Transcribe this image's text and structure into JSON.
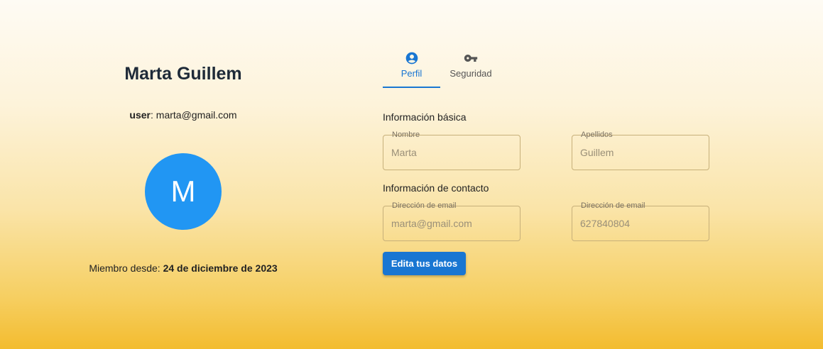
{
  "profile": {
    "name": "Marta Guillem",
    "user_label": "user",
    "user_value": ": marta@gmail.com",
    "avatar_initial": "M",
    "member_since_label": "Miembro desde: ",
    "member_since_value": "24 de diciembre de 2023"
  },
  "tabs": [
    {
      "label": "Perfil",
      "icon": "account-circle-icon",
      "active": true
    },
    {
      "label": "Seguridad",
      "icon": "key-icon",
      "active": false
    }
  ],
  "basic_info": {
    "title": "Información básica",
    "fields": [
      {
        "label": "Nombre",
        "value": "Marta"
      },
      {
        "label": "Apellidos",
        "value": "Guillem"
      }
    ]
  },
  "contact_info": {
    "title": "Información de contacto",
    "fields": [
      {
        "label": "Dirección de email",
        "value": "marta@gmail.com"
      },
      {
        "label": "Dirección de email",
        "value": "627840804"
      }
    ]
  },
  "edit_button_label": "Edita tus datos",
  "colors": {
    "accent": "#1976d2",
    "avatar": "#2196f3"
  }
}
